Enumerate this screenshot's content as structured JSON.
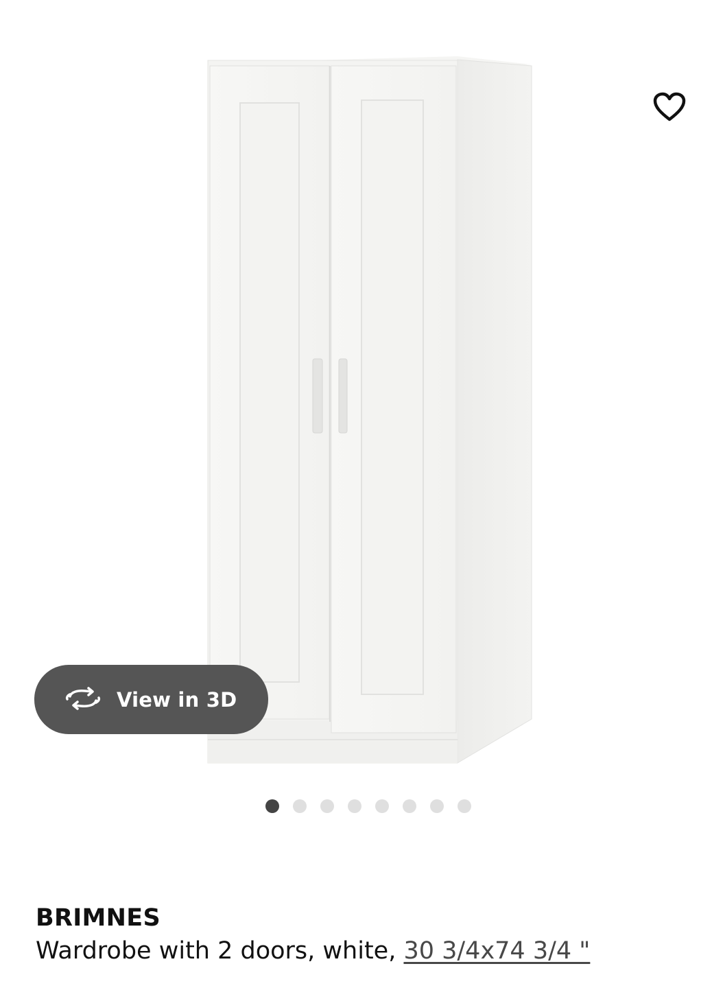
{
  "product": {
    "name": "BRIMNES",
    "description_prefix": "Wardrobe with 2 doors, white, ",
    "size_link": "30 3/4x74 3/4 \""
  },
  "actions": {
    "view3d_label": "View in 3D",
    "favorite_icon": "heart-outline-icon",
    "view3d_icon": "rotate-3d-icon"
  },
  "carousel": {
    "total_images": 8,
    "active_index": 0
  },
  "colors": {
    "view3d_background": "#555555",
    "dot_active": "#444444",
    "dot_inactive": "#dfdfdf",
    "text": "#111111"
  }
}
